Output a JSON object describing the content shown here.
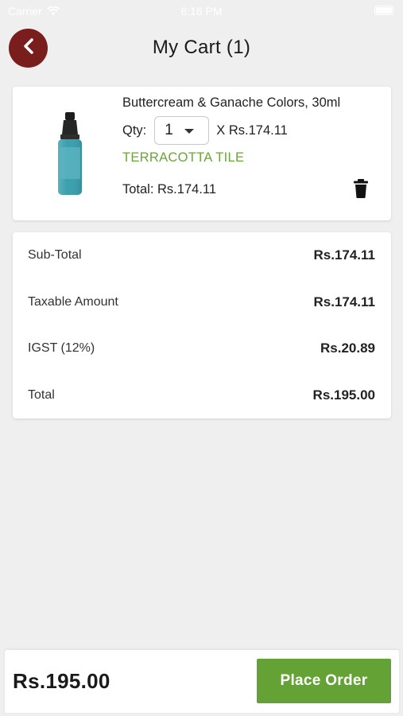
{
  "status_bar": {
    "carrier": "Carrier",
    "time": "8:16 PM"
  },
  "header": {
    "title": "My Cart (1)"
  },
  "cart_item": {
    "name": "Buttercream & Ganache Colors, 30ml",
    "qty_label": "Qty:",
    "qty_value": "1",
    "unit_price": "X Rs.174.11",
    "variant": "TERRACOTTA TILE",
    "total": "Total: Rs.174.11",
    "image_icon": "product-bottle-icon",
    "delete_icon": "trash-icon"
  },
  "summary": {
    "rows": [
      {
        "label": "Sub-Total",
        "value": "Rs.174.11"
      },
      {
        "label": "Taxable Amount",
        "value": "Rs.174.11"
      },
      {
        "label": "IGST (12%)",
        "value": "Rs.20.89"
      },
      {
        "label": "Total",
        "value": "Rs.195.00"
      }
    ]
  },
  "bottom_bar": {
    "grand_total": "Rs.195.00",
    "place_order_label": "Place Order"
  },
  "colors": {
    "background": "#efefef",
    "back_button": "#7a1d1d",
    "accent_green": "#65a236",
    "variant_text": "#6aa637"
  }
}
